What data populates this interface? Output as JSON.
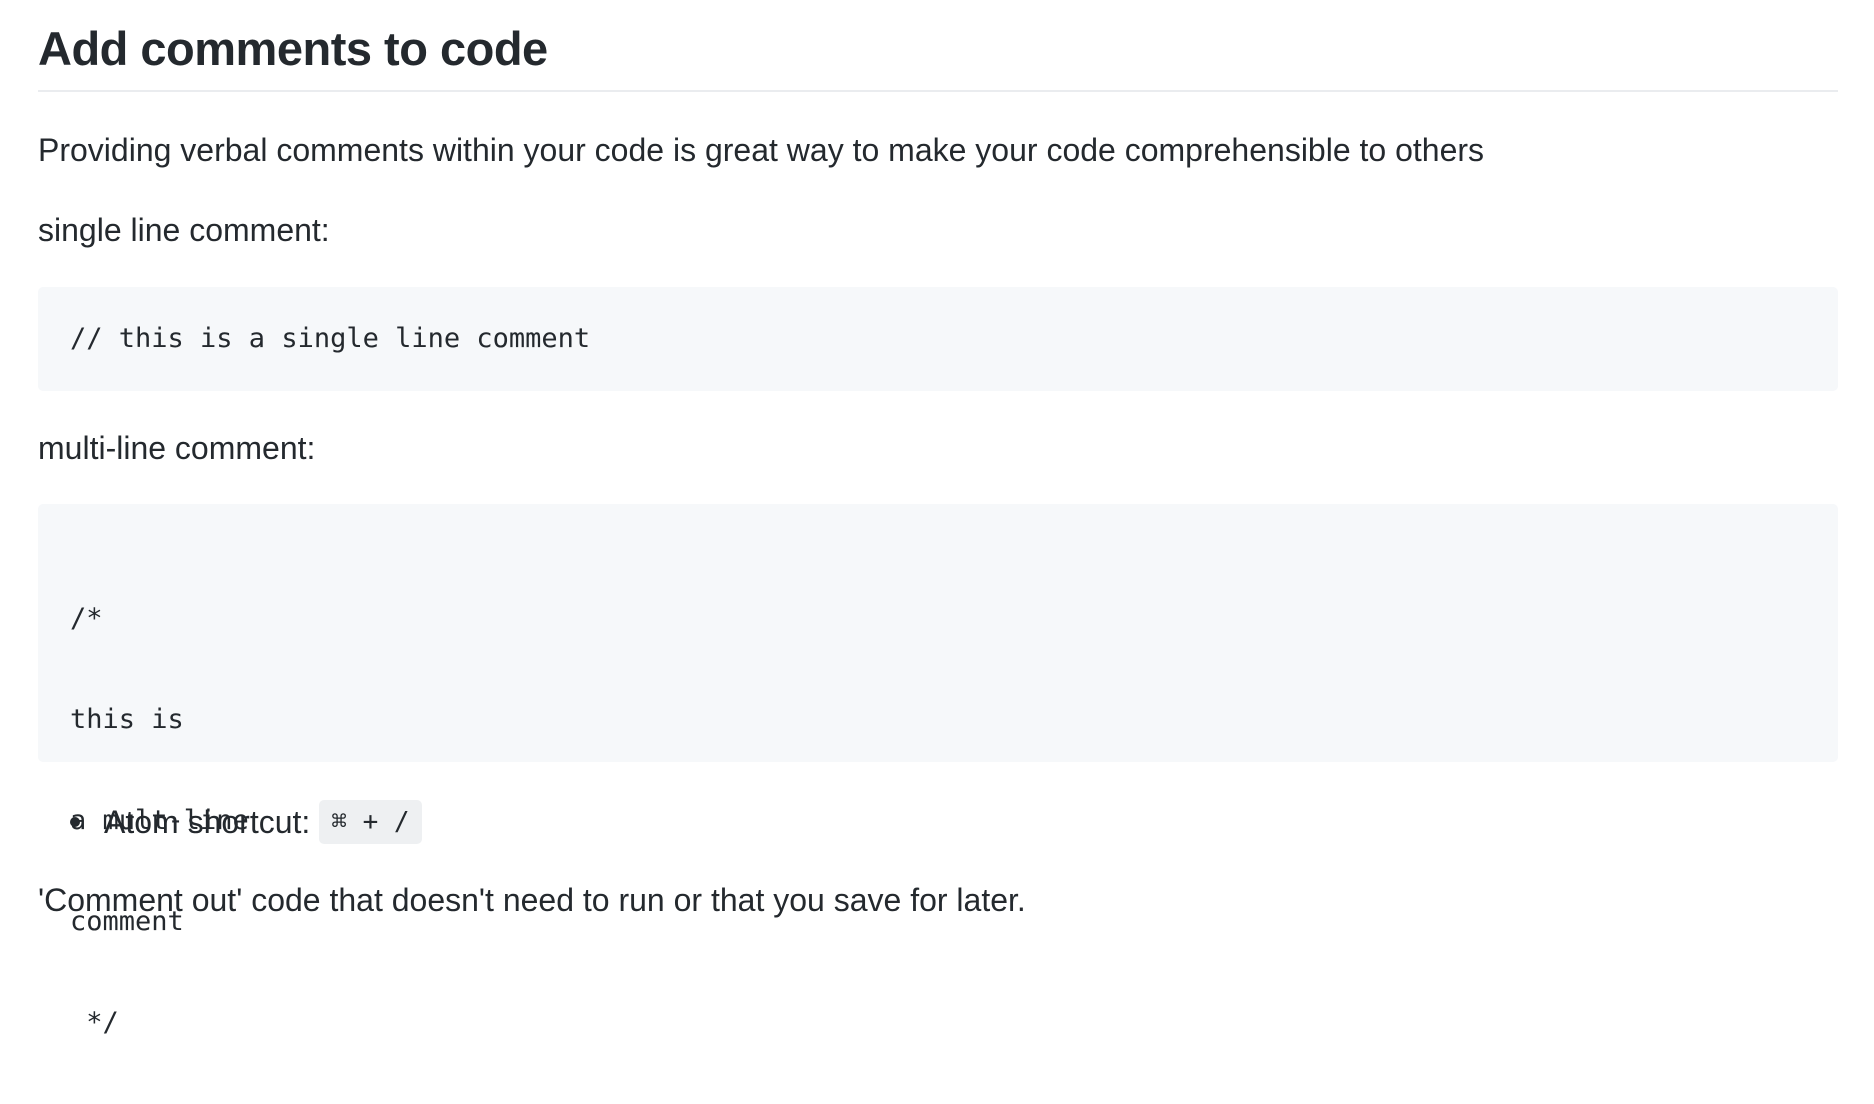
{
  "doc": {
    "title": "Add comments to code",
    "intro": "Providing verbal comments within your code is great way to make your code comprehensible to others",
    "single_label": "single line comment:",
    "single_code": "// this is a single line comment",
    "multi_label": "multi-line comment:",
    "multi_code_lines": [
      "/*",
      "this is",
      "a mult-line",
      "comment",
      " */"
    ],
    "bullets": [
      {
        "label": "Atom shortcut:",
        "code": "⌘ + /"
      }
    ],
    "comment_out": "'Comment out' code that doesn't need to run or that you save for later."
  }
}
